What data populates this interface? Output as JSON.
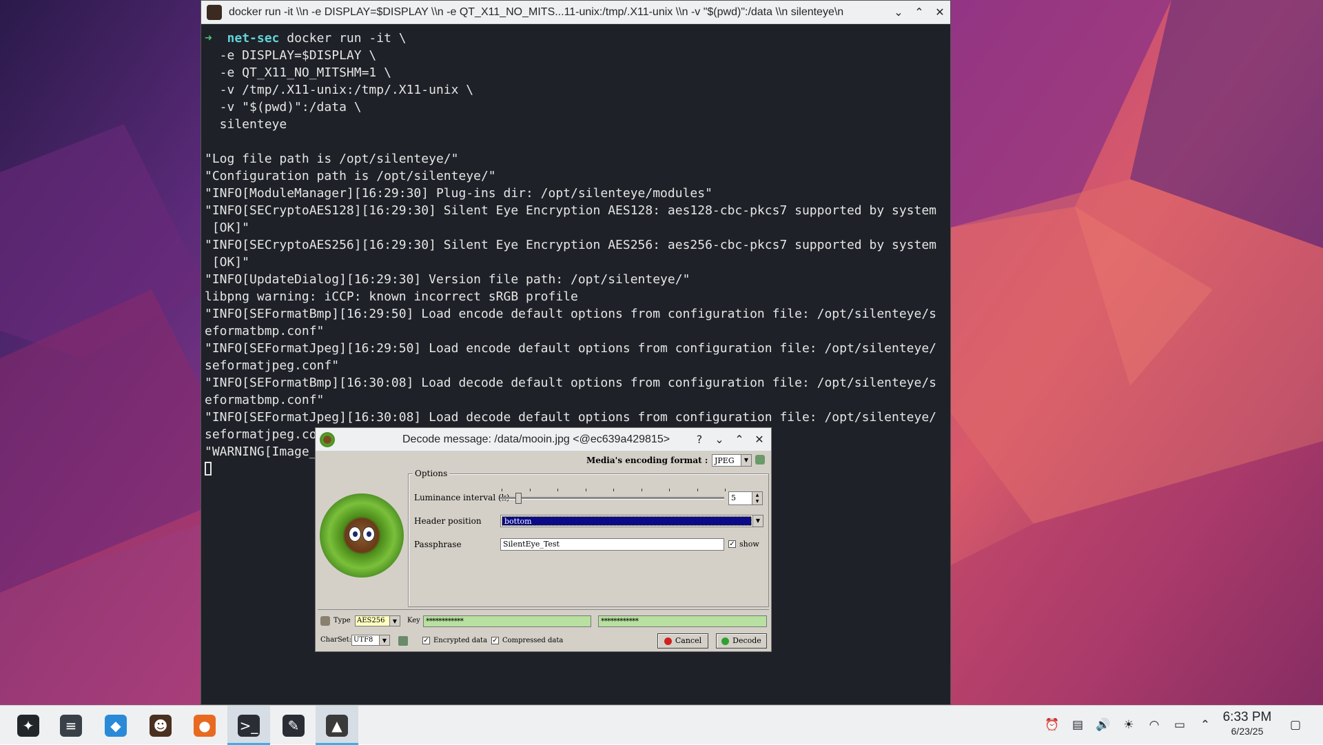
{
  "terminal": {
    "title": "docker run -it \\\\n -e DISPLAY=$DISPLAY \\\\n -e QT_X11_NO_MITS...11-unix:/tmp/.X11-unix \\\\n -v \"$(pwd)\":/data \\\\n silenteye\\n",
    "prompt_arrow": "➜",
    "prompt_dir": "net-sec",
    "command_first": " docker run -it \\",
    "lines": [
      "  -e DISPLAY=$DISPLAY \\",
      "  -e QT_X11_NO_MITSHM=1 \\",
      "  -v /tmp/.X11-unix:/tmp/.X11-unix \\",
      "  -v \"$(pwd)\":/data \\",
      "  silenteye",
      "",
      "\"Log file path is /opt/silenteye/\"",
      "\"Configuration path is /opt/silenteye/\"",
      "\"INFO[ModuleManager][16:29:30] Plug-ins dir: /opt/silenteye/modules\"",
      "\"INFO[SECryptoAES128][16:29:30] Silent Eye Encryption AES128: aes128-cbc-pkcs7 supported by system",
      " [OK]\"",
      "\"INFO[SECryptoAES256][16:29:30] Silent Eye Encryption AES256: aes256-cbc-pkcs7 supported by system",
      " [OK]\"",
      "\"INFO[UpdateDialog][16:29:30] Version file path: /opt/silenteye/\"",
      "libpng warning: iCCP: known incorrect sRGB profile",
      "\"INFO[SEFormatBmp][16:29:50] Load encode default options from configuration file: /opt/silenteye/s",
      "eformatbmp.conf\"",
      "\"INFO[SEFormatJpeg][16:29:50] Load encode default options from configuration file: /opt/silenteye/",
      "seformatjpeg.conf\"",
      "\"INFO[SEFormatBmp][16:30:08] Load decode default options from configuration file: /opt/silenteye/s",
      "eformatbmp.conf\"",
      "\"INFO[SEFormatJpeg][16:30:08] Load decode default options from configuration file: /opt/silenteye/",
      "seformatjpeg.co",
      "\"WARNING[Image_"
    ]
  },
  "dialog": {
    "title": "Decode message: /data/mooin.jpg <@ec639a429815>",
    "help": "?",
    "media_format_label": "Media's encoding format :",
    "media_format_value": "JPEG",
    "options_legend": "Options",
    "luminance_label": "Luminance interval (k)",
    "luminance_value": "5",
    "luminance_fraction": 0.05,
    "header_position_label": "Header position",
    "header_position_value": "bottom",
    "passphrase_label": "Passphrase",
    "passphrase_value": "SilentEye_Test",
    "show_label": "show",
    "show_checked": "✓",
    "type_label": "Type",
    "type_value": "AES256",
    "key_label": "Key",
    "key_value_1": "************",
    "key_value_2": "************",
    "charset_label": "CharSet:",
    "charset_value": "UTF8",
    "encrypted_label": "Encrypted data",
    "encrypted_checked": "✓",
    "compressed_label": "Compressed data",
    "compressed_checked": "✓",
    "cancel_label": "Cancel",
    "decode_label": "Decode"
  },
  "taskbar": {
    "apps": [
      {
        "name": "application-launcher-icon",
        "glyph": "✦",
        "color": "#232629"
      },
      {
        "name": "system-settings-icon",
        "glyph": "≡",
        "color": "#3a4048"
      },
      {
        "name": "discover-store-icon",
        "glyph": "◆",
        "color": "#2a8ad8"
      },
      {
        "name": "silenteye-icon",
        "glyph": "☻",
        "color": "#4a3020"
      },
      {
        "name": "firefox-icon",
        "glyph": "●",
        "color": "#e86a20"
      },
      {
        "name": "terminal-icon",
        "glyph": ">_",
        "color": "#2a2e34"
      },
      {
        "name": "text-editor-icon",
        "glyph": "✎",
        "color": "#2a2e34"
      },
      {
        "name": "silenteye-app-icon",
        "glyph": "▲",
        "color": "#3a3a3a"
      }
    ],
    "active_indices": [
      5,
      7
    ],
    "tray_icons": [
      "notifications-icon",
      "clipboard-icon",
      "volume-icon",
      "brightness-icon",
      "wifi-icon",
      "battery-icon",
      "show-hidden-icon"
    ],
    "clock_time": "6:33 PM",
    "clock_date": "6/23/25"
  }
}
